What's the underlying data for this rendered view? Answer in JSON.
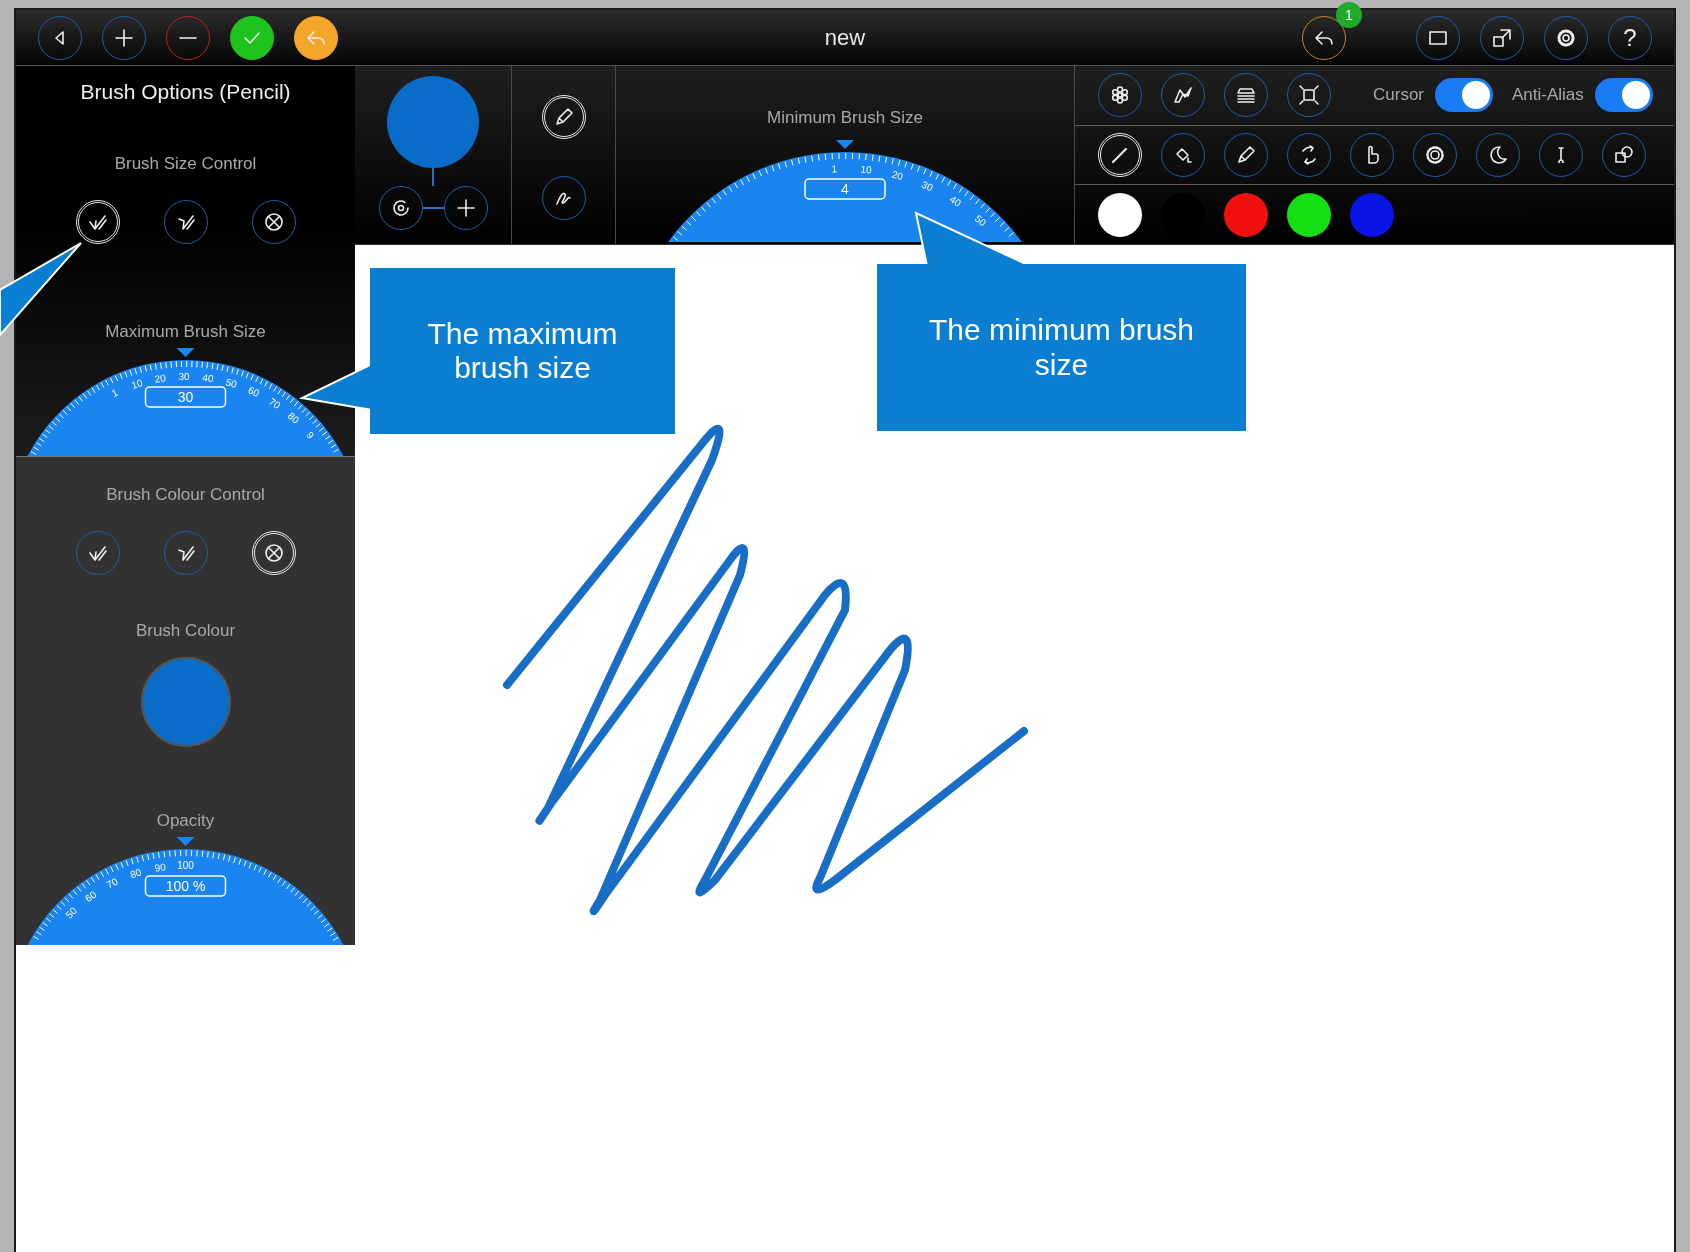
{
  "top_bar": {
    "left_buttons": [
      {
        "kind": "back"
      },
      {
        "kind": "add"
      },
      {
        "kind": "remove"
      },
      {
        "kind": "confirm"
      },
      {
        "kind": "reply"
      }
    ],
    "title": "new",
    "right_buttons": [
      {
        "kind": "undo",
        "badge": "1"
      },
      {
        "kind": "frame"
      },
      {
        "kind": "share"
      },
      {
        "kind": "settings"
      },
      {
        "kind": "help",
        "glyph": "?"
      }
    ]
  },
  "brush_options": {
    "title": "Brush Options (Pencil)",
    "size_control": {
      "label": "Brush Size Control",
      "modes": [
        {
          "kind": "increase",
          "selected": true
        },
        {
          "kind": "decrease",
          "selected": false
        },
        {
          "kind": "off",
          "selected": false
        }
      ]
    },
    "max_size": {
      "label": "Maximum Brush Size",
      "value": "30",
      "ticks": [
        "1",
        "10",
        "20",
        "30",
        "40",
        "50",
        "60",
        "70",
        "80",
        "9"
      ]
    },
    "colour_control": {
      "label": "Brush Colour Control",
      "modes": [
        {
          "kind": "increase",
          "selected": false
        },
        {
          "kind": "decrease",
          "selected": false
        },
        {
          "kind": "off",
          "selected": true
        }
      ]
    },
    "brush_colour": {
      "label": "Brush Colour",
      "color": "#0a6cc9"
    },
    "opacity": {
      "label": "Opacity",
      "value": "100 %",
      "ticks": [
        "50",
        "60",
        "70",
        "80",
        "90",
        "100"
      ]
    }
  },
  "preview": {
    "color": "#0a6cc9",
    "buttons": [
      {
        "kind": "spiral"
      },
      {
        "kind": "add"
      }
    ]
  },
  "pen_modes": [
    {
      "kind": "pencil",
      "selected": true
    },
    {
      "kind": "signature",
      "selected": false
    }
  ],
  "min_size": {
    "label": "Minimum Brush Size",
    "value": "4",
    "ticks": [
      "1",
      "10",
      "20",
      "30",
      "40",
      "50"
    ]
  },
  "utility_buttons": [
    {
      "kind": "flower"
    },
    {
      "kind": "zigzag"
    },
    {
      "kind": "layers"
    },
    {
      "kind": "crop"
    }
  ],
  "toggles": [
    {
      "label": "Cursor",
      "on": true
    },
    {
      "label": "Anti-Alias",
      "on": true
    }
  ],
  "tools": [
    {
      "kind": "brush",
      "selected": true
    },
    {
      "kind": "bucket",
      "selected": false
    },
    {
      "kind": "pencil",
      "selected": false
    },
    {
      "kind": "rotate",
      "selected": false
    },
    {
      "kind": "hand",
      "selected": false
    },
    {
      "kind": "sun",
      "selected": false
    },
    {
      "kind": "moon",
      "selected": false
    },
    {
      "kind": "dropper",
      "selected": false
    },
    {
      "kind": "shapes",
      "selected": false
    }
  ],
  "swatches": [
    {
      "color": "#ffffff"
    },
    {
      "color": "#000000"
    },
    {
      "color": "#f20f0f"
    },
    {
      "color": "#14e014"
    },
    {
      "color": "#0a14e6"
    }
  ],
  "callouts": [
    {
      "text": "The maximum brush size"
    },
    {
      "text": "The minimum brush size"
    }
  ]
}
